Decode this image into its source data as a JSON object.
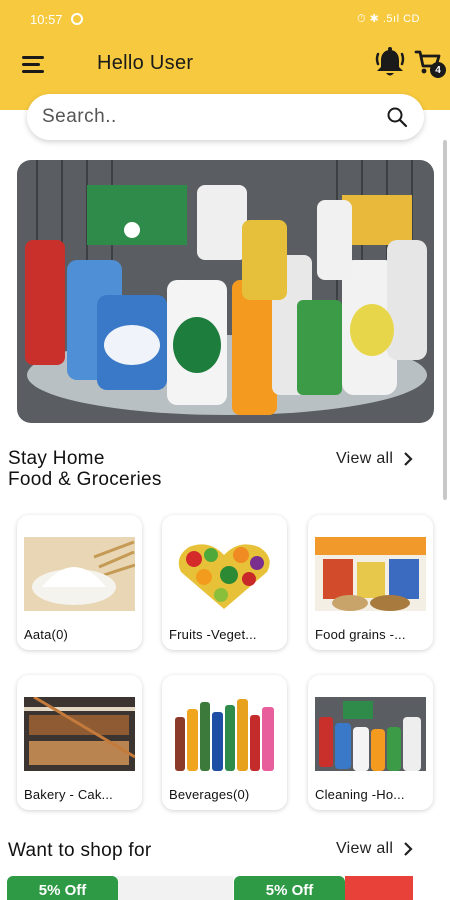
{
  "status_bar": {
    "time": "10:57",
    "right": "⏱ ✱ .5ıl CD"
  },
  "app_bar": {
    "title": "Hello User",
    "cart_count": "4"
  },
  "search": {
    "placeholder": "Search.."
  },
  "section_food": {
    "title_line1": "Stay Home",
    "title_line2": "Food & Groceries",
    "view_all": "View all"
  },
  "categories": [
    {
      "label": "Aata(0)",
      "image": "flour-image"
    },
    {
      "label": "Fruits -Veget...",
      "image": "fruits-vegetables-image"
    },
    {
      "label": "Food grains -...",
      "image": "food-grains-image"
    },
    {
      "label": "Bakery - Cak...",
      "image": "bakery-image"
    },
    {
      "label": "Beverages(0)",
      "image": "beverages-image"
    },
    {
      "label": "Cleaning -Ho...",
      "image": "cleaning-image"
    }
  ],
  "section_shop": {
    "title": "Want to shop for",
    "view_all": "View all"
  },
  "offers": [
    {
      "badge": "5% Off"
    },
    {
      "badge": "5% Off"
    }
  ],
  "colors": {
    "brand_yellow": "#f7c93e",
    "offer_green": "#2e9a45"
  }
}
